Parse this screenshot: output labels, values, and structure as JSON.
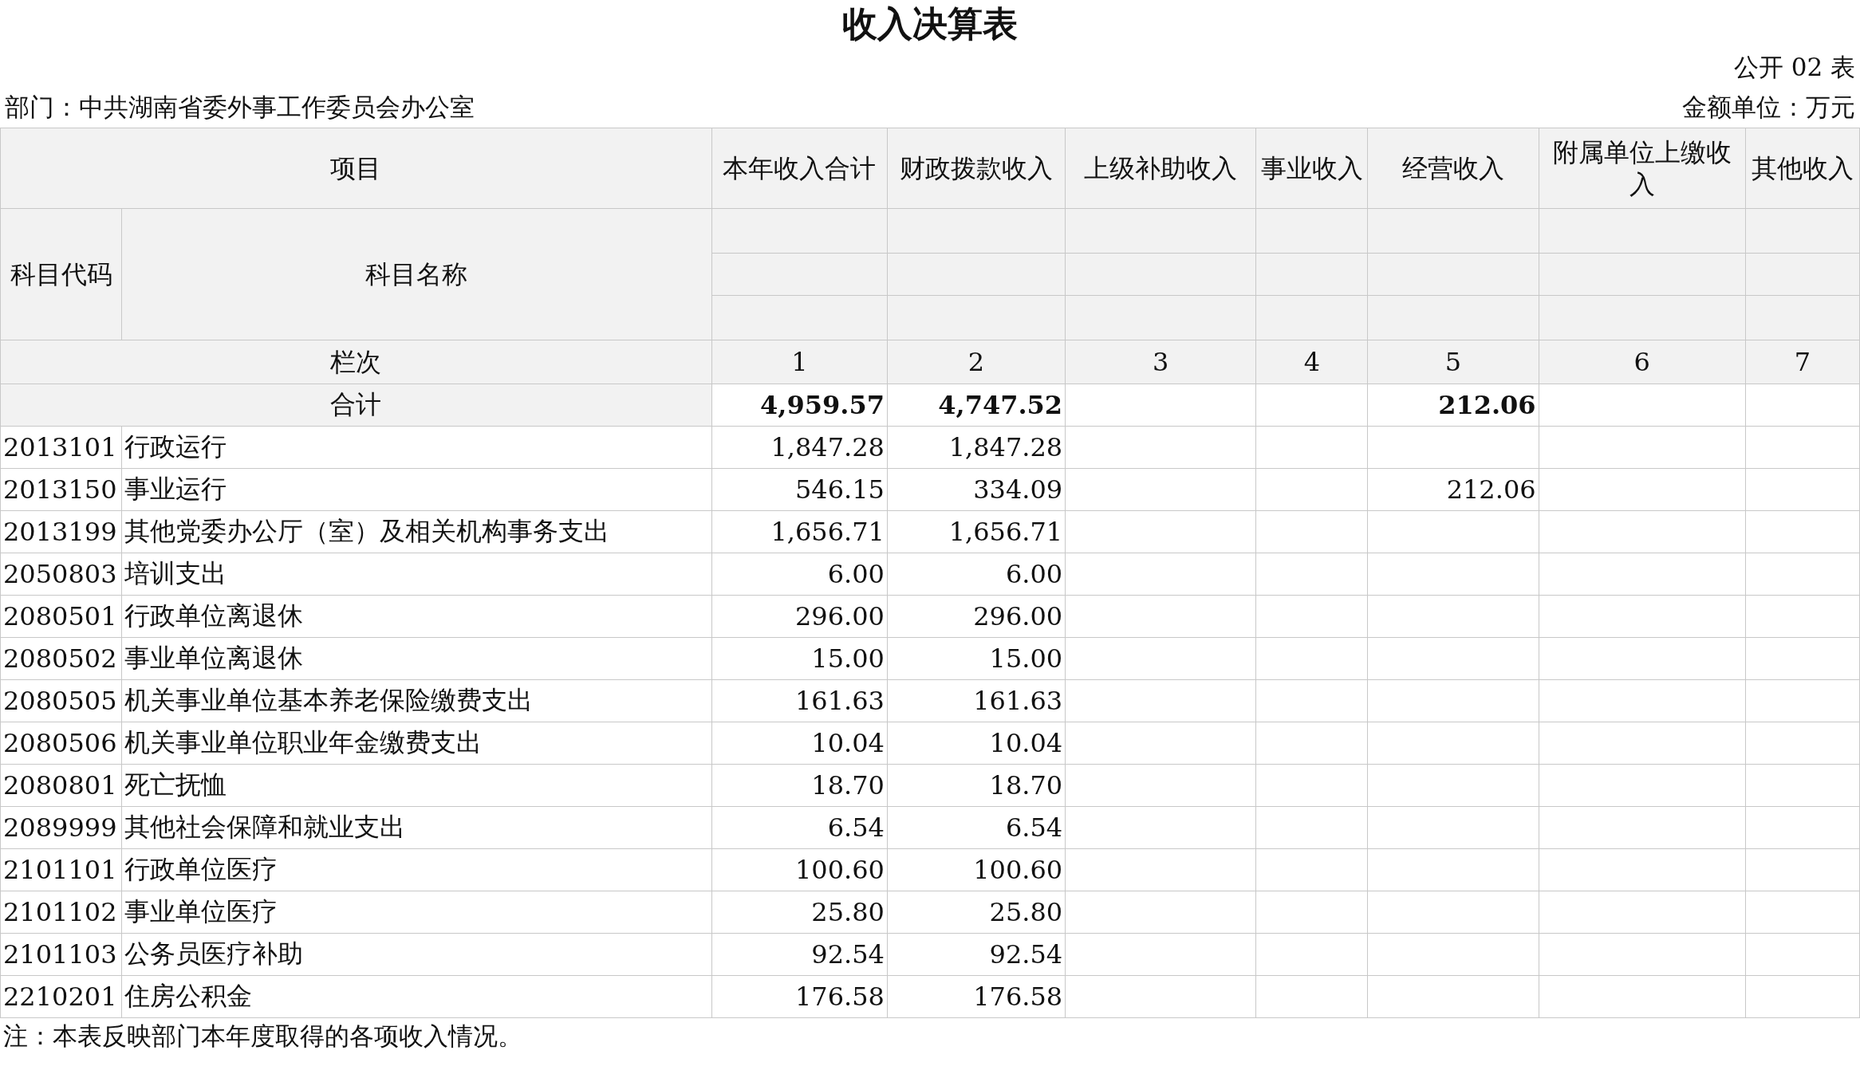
{
  "title": "收入决算表",
  "table_no": "公开 02 表",
  "department": "部门：中共湖南省委外事工作委员会办公室",
  "unit": "金额单位：万元",
  "table": {
    "item_header": "项目",
    "code_header": "科目代码",
    "name_header": "科目名称",
    "columns": [
      "本年收入合计",
      "财政拨款收入",
      "上级补助收入",
      "事业收入",
      "经营收入",
      "附属单位上缴收入",
      "其他收入"
    ],
    "index_label": "栏次",
    "column_numbers": [
      "1",
      "2",
      "3",
      "4",
      "5",
      "6",
      "7"
    ],
    "total": {
      "label": "合计",
      "cells": [
        "4,959.57",
        "4,747.52",
        null,
        null,
        "212.06",
        null,
        null
      ]
    },
    "rows": [
      {
        "code": "2013101",
        "name": "行政运行",
        "cells": [
          "1,847.28",
          "1,847.28",
          null,
          null,
          null,
          null,
          null
        ]
      },
      {
        "code": "2013150",
        "name": "事业运行",
        "cells": [
          "546.15",
          "334.09",
          null,
          null,
          "212.06",
          null,
          null
        ]
      },
      {
        "code": "2013199",
        "name": "其他党委办公厅（室）及相关机构事务支出",
        "cells": [
          "1,656.71",
          "1,656.71",
          null,
          null,
          null,
          null,
          null
        ]
      },
      {
        "code": "2050803",
        "name": "培训支出",
        "cells": [
          "6.00",
          "6.00",
          null,
          null,
          null,
          null,
          null
        ]
      },
      {
        "code": "2080501",
        "name": "行政单位离退休",
        "cells": [
          "296.00",
          "296.00",
          null,
          null,
          null,
          null,
          null
        ]
      },
      {
        "code": "2080502",
        "name": "事业单位离退休",
        "cells": [
          "15.00",
          "15.00",
          null,
          null,
          null,
          null,
          null
        ]
      },
      {
        "code": "2080505",
        "name": "机关事业单位基本养老保险缴费支出",
        "cells": [
          "161.63",
          "161.63",
          null,
          null,
          null,
          null,
          null
        ]
      },
      {
        "code": "2080506",
        "name": "机关事业单位职业年金缴费支出",
        "cells": [
          "10.04",
          "10.04",
          null,
          null,
          null,
          null,
          null
        ]
      },
      {
        "code": "2080801",
        "name": "死亡抚恤",
        "cells": [
          "18.70",
          "18.70",
          null,
          null,
          null,
          null,
          null
        ]
      },
      {
        "code": "2089999",
        "name": "其他社会保障和就业支出",
        "cells": [
          "6.54",
          "6.54",
          null,
          null,
          null,
          null,
          null
        ]
      },
      {
        "code": "2101101",
        "name": "行政单位医疗",
        "cells": [
          "100.60",
          "100.60",
          null,
          null,
          null,
          null,
          null
        ]
      },
      {
        "code": "2101102",
        "name": "事业单位医疗",
        "cells": [
          "25.80",
          "25.80",
          null,
          null,
          null,
          null,
          null
        ]
      },
      {
        "code": "2101103",
        "name": "公务员医疗补助",
        "cells": [
          "92.54",
          "92.54",
          null,
          null,
          null,
          null,
          null
        ]
      },
      {
        "code": "2210201",
        "name": "住房公积金",
        "cells": [
          "176.58",
          "176.58",
          null,
          null,
          null,
          null,
          null
        ]
      }
    ]
  },
  "note": "注：本表反映部门本年度取得的各项收入情况。"
}
